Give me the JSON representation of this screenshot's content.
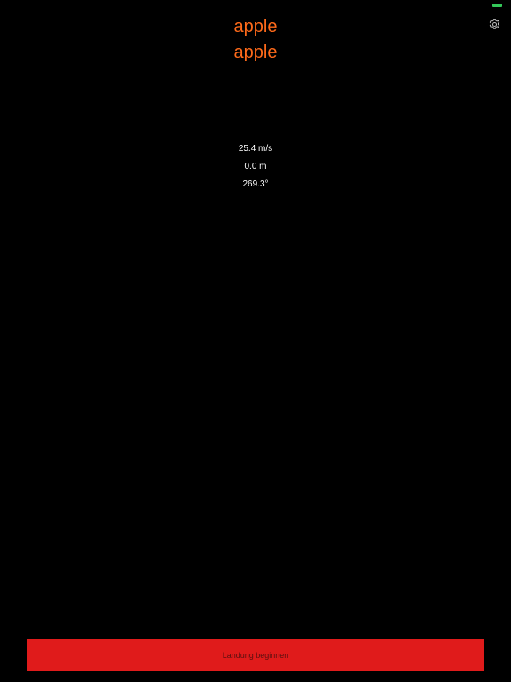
{
  "status_bar": {
    "battery_color": "#34c759"
  },
  "header": {
    "title_line_1": "apple",
    "title_line_2": "apple",
    "title_color": "#ff6a1a",
    "settings_icon": "gear-icon"
  },
  "readouts": {
    "speed": "25.4 m/s",
    "altitude": "0.0 m",
    "heading": "269.3°"
  },
  "footer": {
    "button_label": "Landung beginnen",
    "button_color": "#e01b1b"
  }
}
